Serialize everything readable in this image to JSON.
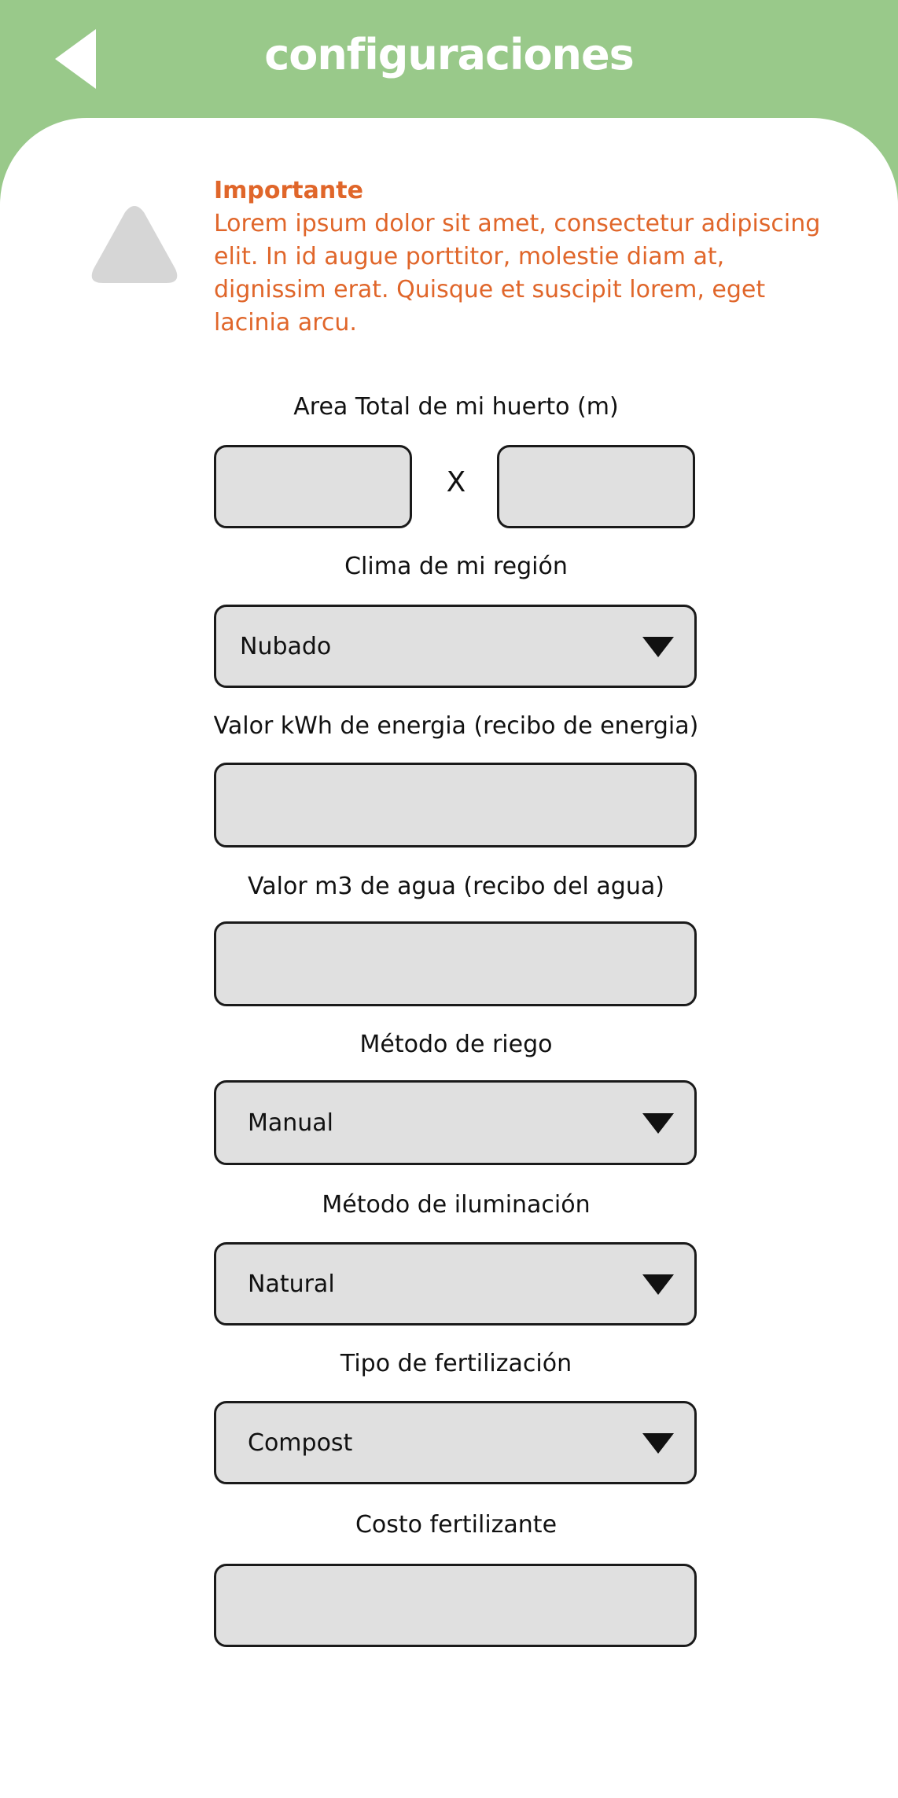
{
  "header": {
    "title": "configuraciones",
    "back_icon": "back-arrow-icon"
  },
  "notice": {
    "icon": "warning-triangle-icon",
    "title": "Importante",
    "body": "Lorem ipsum dolor sit amet, consectetur adipiscing elit. In id augue porttitor, molestie diam at, dignissim erat. Quisque et suscipit lorem, eget lacinia arcu."
  },
  "form": {
    "area": {
      "label": "Area Total de mi huerto (m)",
      "separator": "X",
      "width_value": "",
      "length_value": ""
    },
    "climate": {
      "label": "Clima de mi región",
      "selected": "Nubado"
    },
    "energy": {
      "label": "Valor kWh de energia (recibo de energia)",
      "value": ""
    },
    "water": {
      "label": "Valor m3 de agua (recibo del agua)",
      "value": ""
    },
    "irrigation": {
      "label": "Método de riego",
      "selected": "Manual"
    },
    "lighting": {
      "label": "Método de iluminación",
      "selected": "Natural"
    },
    "fertilization": {
      "label": "Tipo de fertilización",
      "selected": "Compost"
    },
    "fertilizer_cost": {
      "label": "Costo fertilizante",
      "value": ""
    }
  },
  "colors": {
    "header_green": "#99c98a",
    "notice_orange": "#e0662a",
    "field_fill": "#e0e0e0",
    "icon_gray": "#d6d6d6"
  }
}
